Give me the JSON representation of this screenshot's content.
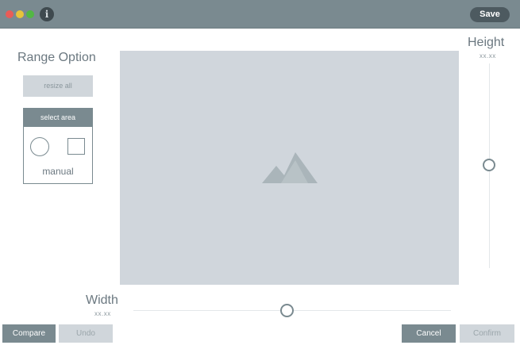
{
  "window": {
    "colors": {
      "titlebar": "#7a8a90",
      "close": "#e95c57",
      "minimize": "#e7c33a",
      "maximize": "#52b743"
    },
    "info_icon_glyph": "i",
    "save_label": "Save"
  },
  "range_panel": {
    "title": "Range Option",
    "resize_all_label": "resize all",
    "select_area": {
      "header": "select area",
      "shapes": [
        "circle-icon",
        "square-icon"
      ],
      "mode_label": "manual"
    }
  },
  "canvas": {
    "placeholder_icon": "image-placeholder-icon",
    "background": "#d0d6dc"
  },
  "height": {
    "label": "Height",
    "value": "xx.xx",
    "slider_level": 0.48
  },
  "width": {
    "label": "Width",
    "value": "xx.xx",
    "slider_level": 0.48
  },
  "footer": {
    "compare_label": "Compare",
    "undo_label": "Undo",
    "cancel_label": "Cancel",
    "confirm_label": "Confirm"
  }
}
